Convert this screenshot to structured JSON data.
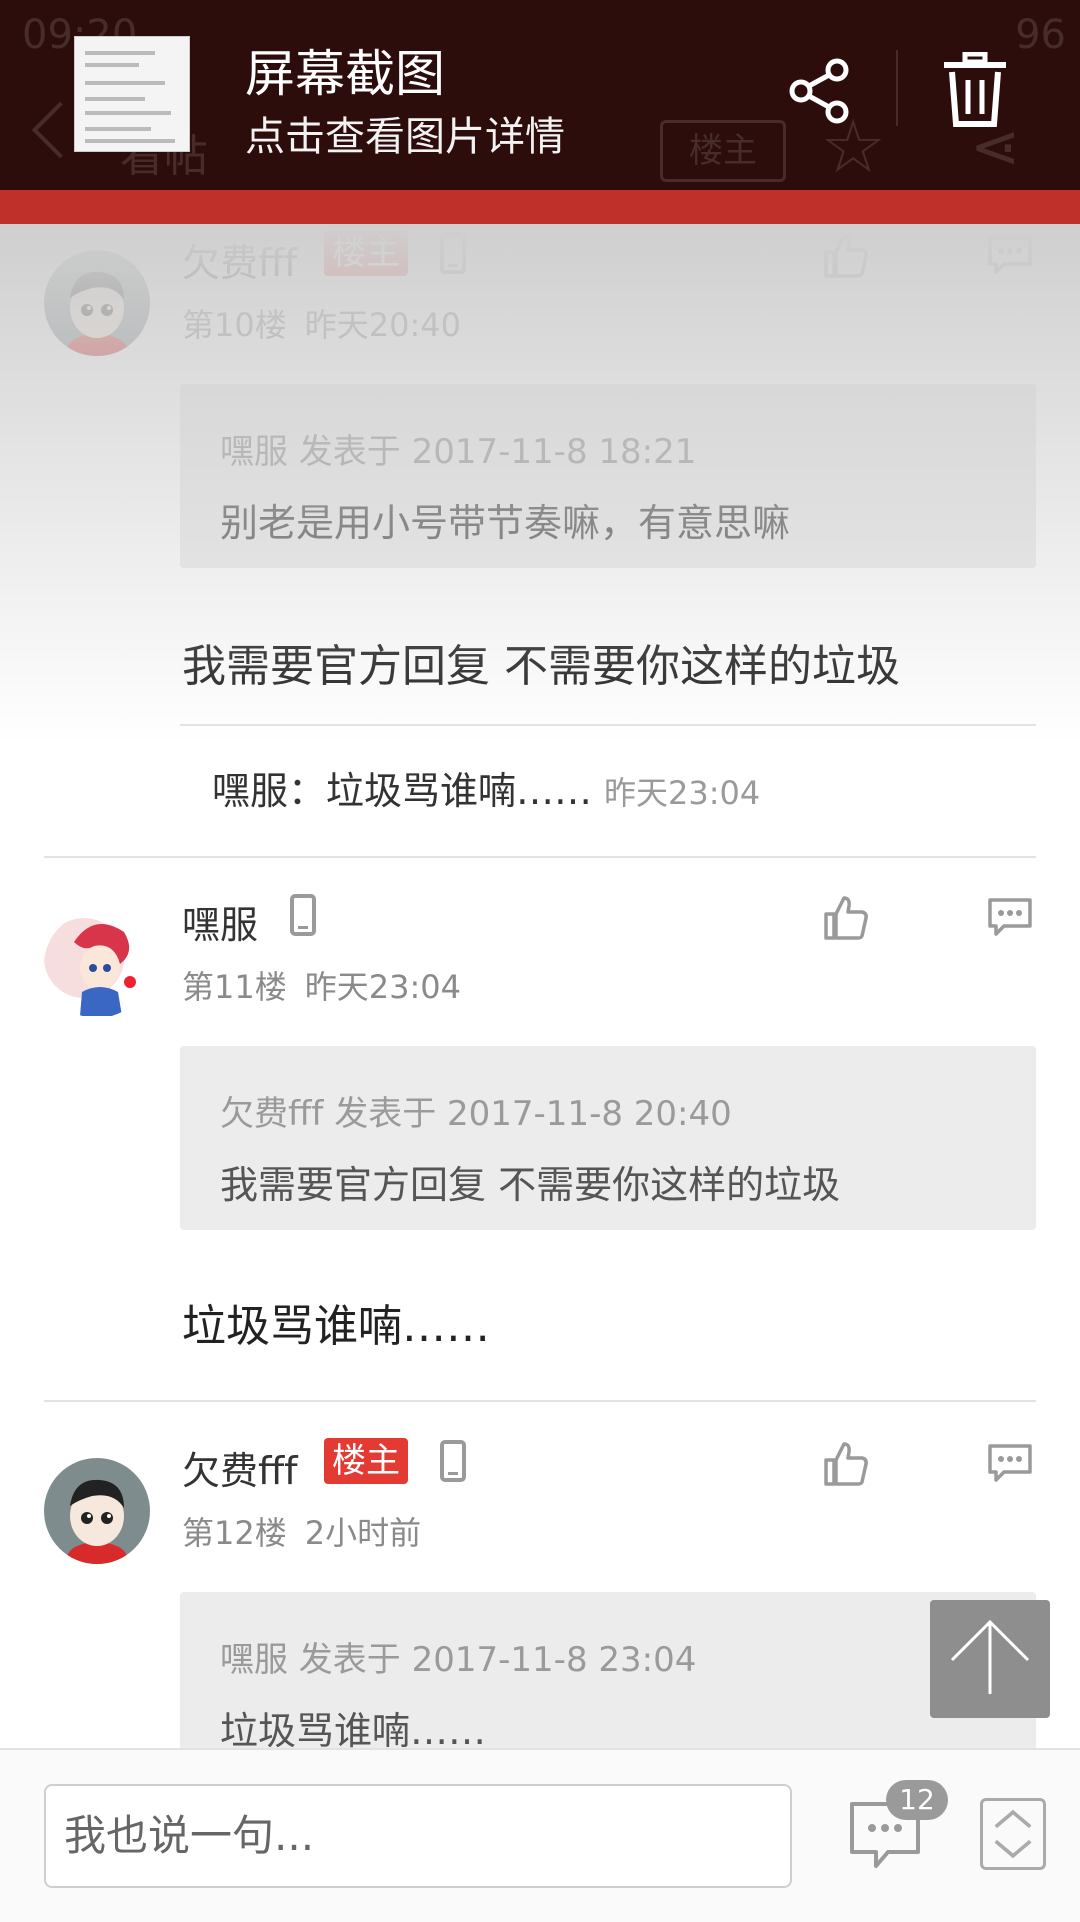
{
  "notification": {
    "title": "屏幕截图",
    "subtitle": "点击查看图片详情"
  },
  "background_header": {
    "time": "09:20",
    "battery": "96",
    "title": "看帖",
    "owner_button": "楼主"
  },
  "posts": [
    {
      "author": "欠费fff",
      "badge": "楼主",
      "floor": "第10楼",
      "time": "昨天20:40",
      "quote_meta": "嘿服 发表于 2017-11-8 18:21",
      "quote_text": "别老是用小号带节奏嘛，有意思嘛",
      "body": "我需要官方回复 不需要你这样的垃圾",
      "sub_reply_text": "嘿服：垃圾骂谁喃……",
      "sub_reply_time": "昨天23:04"
    },
    {
      "author": "嘿服",
      "floor": "第11楼",
      "time": "昨天23:04",
      "quote_meta": "欠费fff 发表于 2017-11-8 20:40",
      "quote_text": "我需要官方回复 不需要你这样的垃圾",
      "body": "垃圾骂谁喃……"
    },
    {
      "author": "欠费fff",
      "badge": "楼主",
      "floor": "第12楼",
      "time": "2小时前",
      "quote_meta": "嘿服 发表于 2017-11-8 23:04",
      "quote_text": "垃圾骂谁喃……"
    }
  ],
  "bottom_bar": {
    "input_placeholder": "我也说一句...",
    "comment_count": "12"
  },
  "colors": {
    "accent_red": "#c0302a",
    "badge_red": "#e33b34",
    "overlay_bg": "#2c0d0b"
  }
}
